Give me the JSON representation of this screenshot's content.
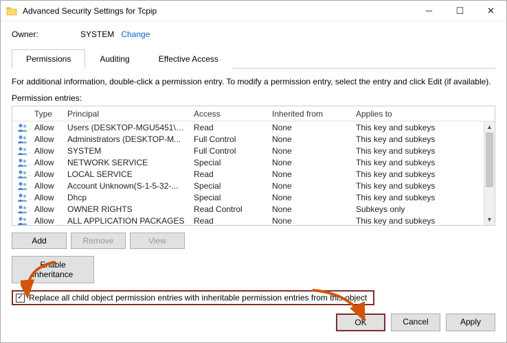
{
  "window": {
    "title": "Advanced Security Settings for Tcpip"
  },
  "owner": {
    "label": "Owner:",
    "value": "SYSTEM",
    "change": "Change"
  },
  "tabs": {
    "permissions": "Permissions",
    "auditing": "Auditing",
    "effective_access": "Effective Access"
  },
  "instructions": "For additional information, double-click a permission entry. To modify a permission entry, select the entry and click Edit (if available).",
  "entries_label": "Permission entries:",
  "headers": {
    "type": "Type",
    "principal": "Principal",
    "access": "Access",
    "inherited": "Inherited from",
    "applies": "Applies to"
  },
  "entries": [
    {
      "type": "Allow",
      "principal": "Users (DESKTOP-MGU5451\\U...",
      "access": "Read",
      "inherited": "None",
      "applies": "This key and subkeys"
    },
    {
      "type": "Allow",
      "principal": "Administrators (DESKTOP-M...",
      "access": "Full Control",
      "inherited": "None",
      "applies": "This key and subkeys"
    },
    {
      "type": "Allow",
      "principal": "SYSTEM",
      "access": "Full Control",
      "inherited": "None",
      "applies": "This key and subkeys"
    },
    {
      "type": "Allow",
      "principal": "NETWORK SERVICE",
      "access": "Special",
      "inherited": "None",
      "applies": "This key and subkeys"
    },
    {
      "type": "Allow",
      "principal": "LOCAL SERVICE",
      "access": "Read",
      "inherited": "None",
      "applies": "This key and subkeys"
    },
    {
      "type": "Allow",
      "principal": "Account Unknown(S-1-5-32-...",
      "access": "Special",
      "inherited": "None",
      "applies": "This key and subkeys"
    },
    {
      "type": "Allow",
      "principal": "Dhcp",
      "access": "Special",
      "inherited": "None",
      "applies": "This key and subkeys"
    },
    {
      "type": "Allow",
      "principal": "OWNER RIGHTS",
      "access": "Read Control",
      "inherited": "None",
      "applies": "Subkeys only"
    },
    {
      "type": "Allow",
      "principal": "ALL APPLICATION PACKAGES",
      "access": "Read",
      "inherited": "None",
      "applies": "This key and subkeys"
    }
  ],
  "buttons": {
    "add": "Add",
    "remove": "Remove",
    "view": "View",
    "inherit": "Enable inheritance",
    "ok": "OK",
    "cancel": "Cancel",
    "apply": "Apply"
  },
  "checkbox_label": "Replace all child object permission entries with inheritable permission entries from this object"
}
